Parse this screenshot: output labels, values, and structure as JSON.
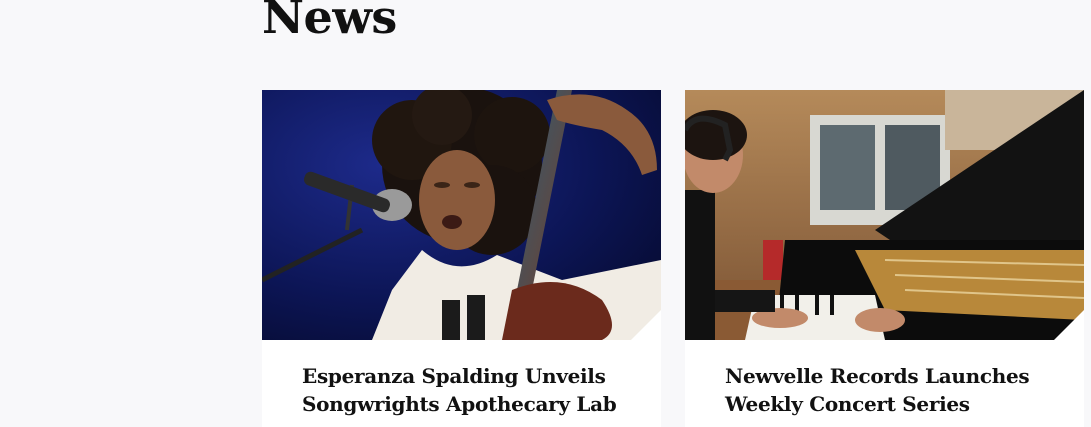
{
  "section": {
    "title": "News"
  },
  "cards": [
    {
      "title": "Esperanza Spalding Unveils Songwrights Apothecary Lab",
      "image_alt": "Esperanza Spalding singing and playing upright bass"
    },
    {
      "title": "Newvelle Records Launches Weekly Concert Series",
      "image_alt": "Pianist playing a grand piano in a recording studio"
    }
  ],
  "colors": {
    "page_background": "#f8f8fa",
    "card_background": "#ffffff",
    "text": "#111111"
  }
}
